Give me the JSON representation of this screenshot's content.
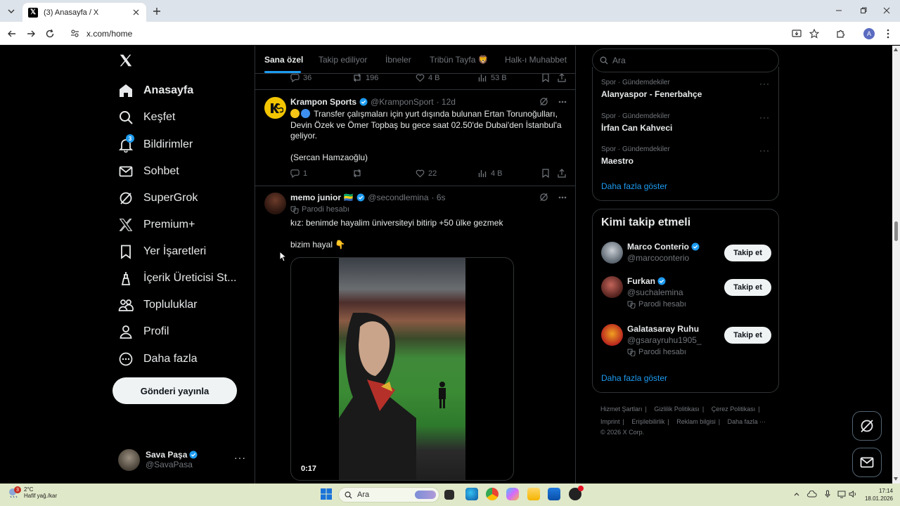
{
  "browser": {
    "tab_title": "(3) Anasayfa / X",
    "url": "x.com/home",
    "profile_initial": "A"
  },
  "sidebar": {
    "items": [
      {
        "label": "Anasayfa",
        "icon": "home-icon"
      },
      {
        "label": "Keşfet",
        "icon": "search-icon"
      },
      {
        "label": "Bildirimler",
        "icon": "bell-icon",
        "badge": "3"
      },
      {
        "label": "Sohbet",
        "icon": "mail-icon"
      },
      {
        "label": "SuperGrok",
        "icon": "grok-icon"
      },
      {
        "label": "Premium+",
        "icon": "x-logo-icon"
      },
      {
        "label": "Yer İşaretleri",
        "icon": "bookmark-icon"
      },
      {
        "label": "İçerik Üreticisi St...",
        "icon": "creator-studio-icon"
      },
      {
        "label": "Topluluklar",
        "icon": "communities-icon"
      },
      {
        "label": "Profil",
        "icon": "profile-icon"
      },
      {
        "label": "Daha fazla",
        "icon": "more-circle-icon"
      }
    ],
    "post_button": "Gönderi yayınla",
    "me": {
      "name": "Sava Paşa",
      "handle": "@SavaPasa",
      "more": "···"
    }
  },
  "feed_tabs": [
    "Sana özel",
    "Takip ediliyor",
    "İbneler",
    "Tribün Tayfa 🦁",
    "Halk-ı Muhabbet"
  ],
  "top_actions": {
    "replies": "36",
    "reposts": "196",
    "likes": "4 B",
    "views": "53 B"
  },
  "posts": [
    {
      "name": "Krampon Sports",
      "handle": "@KramponSport",
      "time": "· 12d",
      "lines": [
        "Transfer çalışmaları için yurt dışında bulunan Ertan Torunoğulları,",
        "Devin Özek ve Ömer Topbaş bu gece saat 02.50'de Dubai'den İstanbul'a",
        "geliyor.",
        "(Sercan Hamzaoğlu)"
      ],
      "replies": "1",
      "reposts": "",
      "likes": "22",
      "views": "4 B"
    },
    {
      "name": "memo junior 🇬🇦",
      "handle": "@secondlemina",
      "time": "· 6s",
      "parody": "Parodi hesabı",
      "line1": "kız: benimde hayalim üniversiteyi bitirip +50 ülke gezmek",
      "line2": "bizim hayal 👇",
      "video_time": "0:17"
    }
  ],
  "right": {
    "search_placeholder": "Ara",
    "trends": [
      {
        "category": "Spor · Gündemdekiler",
        "title": "Alanyaspor - Fenerbahçe"
      },
      {
        "category": "Spor · Gündemdekiler",
        "title": "İrfan Can Kahveci"
      },
      {
        "category": "Spor · Gündemdekiler",
        "title": "Maestro"
      }
    ],
    "show_more": "Daha fazla göster",
    "who_to_follow_title": "Kimi takip etmeli",
    "accounts": [
      {
        "name": "Marco Conterio",
        "handle": "@marcoconterio",
        "parody": ""
      },
      {
        "name": "Furkan",
        "handle": "@suchalemina",
        "parody": "Parodi hesabı"
      },
      {
        "name": "Galatasaray Ruhu",
        "handle": "@gsarayruhu1905_",
        "parody": "Parodi hesabı"
      }
    ],
    "follow_label": "Takip et",
    "show_more_2": "Daha fazla göster",
    "footer": [
      "Hizmet Şartları",
      "Gizlilik Politikası",
      "Çerez Politikası",
      "Imprint",
      "Erişilebilirlik",
      "Reklam bilgisi",
      "Daha fazla ···",
      "© 2026 X Corp."
    ]
  },
  "taskbar": {
    "temp": "2°C",
    "weather": "Hafif yağ./kar",
    "weather_badge": "3",
    "search": "Ara",
    "time": "17:14",
    "date": "18.01.2026"
  }
}
